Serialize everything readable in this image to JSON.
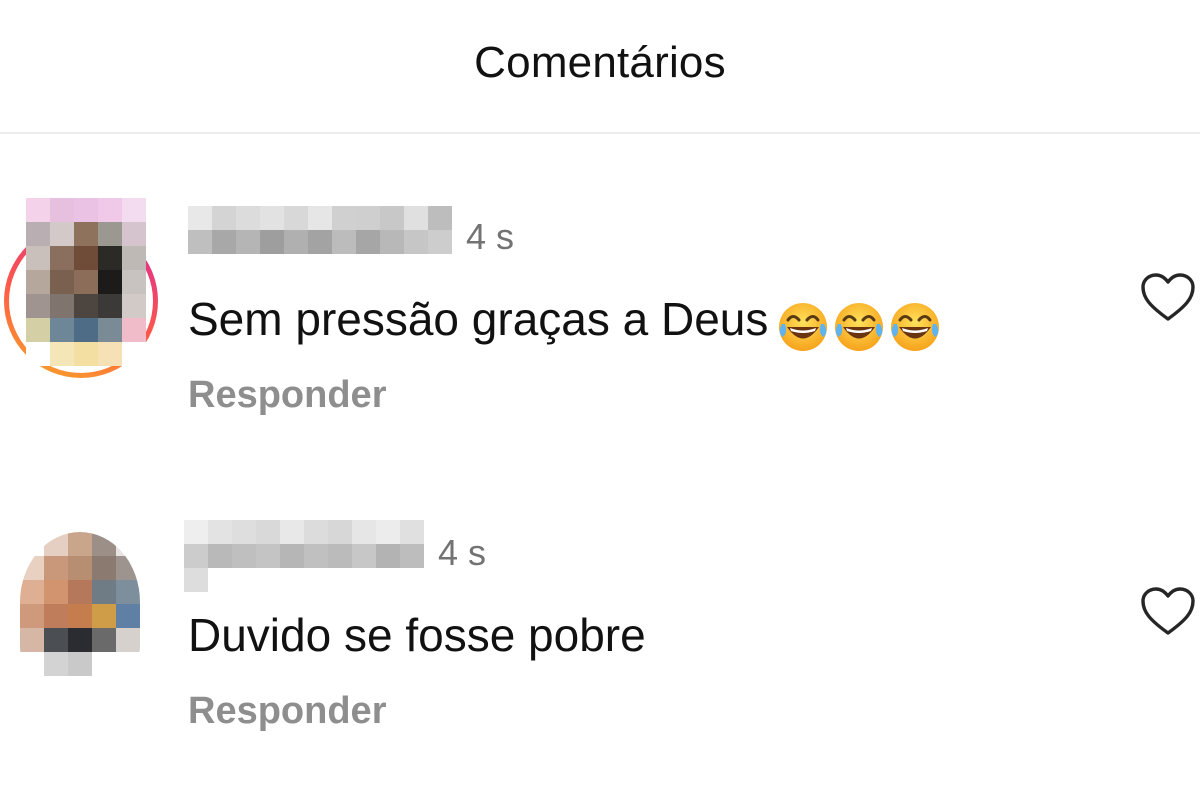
{
  "header": {
    "title": "Comentários"
  },
  "comments": [
    {
      "time": "4 s",
      "text": "Sem pressão graças a Deus",
      "emoji": [
        "face-with-tears-of-joy-icon",
        "face-with-tears-of-joy-icon",
        "face-with-tears-of-joy-icon"
      ],
      "reply_label": "Responder",
      "avatar_has_story_ring": true,
      "avatar_colors": [
        [
          "#f3d2ea",
          "#e6c0de",
          "#eac3e4",
          "#f0c8e8",
          "#f3dcef"
        ],
        [
          "#b9aeb2",
          "#d3c9c8",
          "#8e725c",
          "#9a9891",
          "#d5c3ce"
        ],
        [
          "#c9c0bc",
          "#8a6f5e",
          "#6e4c38",
          "#2c2a27",
          "#bfb9b5"
        ],
        [
          "#b6a79c",
          "#7a604e",
          "#8c6d5a",
          "#1c1b1a",
          "#c8c3c0"
        ],
        [
          "#9f948f",
          "#80746f",
          "#4c4540",
          "#3c3a39",
          "#d1cac7"
        ],
        [
          "#d5cfa6",
          "#6d8698",
          "#4f6c87",
          "#7a8b95",
          "#f1bcc9"
        ],
        [
          "#ffffff",
          "#f5e6b7",
          "#f4dfa3",
          "#f6e1b6",
          "#ffffff"
        ]
      ],
      "username_colors": [
        [
          "#e8e8e8",
          "#d4d4d4",
          "#dcdcdc",
          "#e2e2e2",
          "#d8d8d8",
          "#e6e6e6",
          "#d0d0d0",
          "#cfcfcf",
          "#c8c8c8",
          "#e0e0e0",
          "#bdbdbd"
        ],
        [
          "#bfbfbf",
          "#a8a8a8",
          "#b5b5b5",
          "#9e9e9e",
          "#b0b0b0",
          "#a3a3a3",
          "#bcbcbc",
          "#a6a6a6",
          "#b8b8b8",
          "#c6c6c6",
          "#cdcdcd"
        ]
      ]
    },
    {
      "time": "4 s",
      "text": "Duvido se fosse pobre",
      "emoji": [],
      "reply_label": "Responder",
      "avatar_has_story_ring": false,
      "avatar_colors": [
        [
          "#ffffff",
          "#e4cfc2",
          "#c8a58b",
          "#9b8f88",
          "#e8e4e2"
        ],
        [
          "#e9d1c1",
          "#c9987a",
          "#b88e72",
          "#8a7a70",
          "#9d9490"
        ],
        [
          "#deaf93",
          "#d2936f",
          "#b5785a",
          "#6f7c86",
          "#7d8e9c"
        ],
        [
          "#cf9a7b",
          "#bf7d5b",
          "#c67d4d",
          "#cf9d47",
          "#5f7fa4"
        ],
        [
          "#d6b6a4",
          "#4b4e53",
          "#2a2c31",
          "#6b6a6a",
          "#d6d1cd"
        ],
        [
          "#ffffff",
          "#d3d3d3",
          "#c9c9c9",
          "#ffffff",
          "#ffffff"
        ]
      ],
      "username_colors": [
        [
          "#eeeeee",
          "#e3e3e3",
          "#dedede",
          "#d9d9d9",
          "#e8e8e8",
          "#dcdcdc",
          "#d7d7d7",
          "#e6e6e6",
          "#ececec",
          "#e0e0e0"
        ],
        [
          "#cccccc",
          "#b9b9b9",
          "#bfbfbf",
          "#c4c4c4",
          "#b6b6b6",
          "#c0c0c0",
          "#bbbbbb",
          "#c7c7c7",
          "#b3b3b3",
          "#bdbdbd"
        ],
        [
          "#dddddd",
          "#ffffff",
          "#ffffff",
          "#ffffff",
          "#ffffff",
          "#ffffff",
          "#ffffff",
          "#ffffff",
          "#ffffff",
          "#ffffff"
        ]
      ]
    }
  ],
  "colors": {
    "text": "#111111",
    "secondary_text": "#737373",
    "reply_text": "#8e8e8e",
    "divider": "#ececec",
    "story_ring_start": "#f9a825",
    "story_ring_end": "#d6249f"
  }
}
